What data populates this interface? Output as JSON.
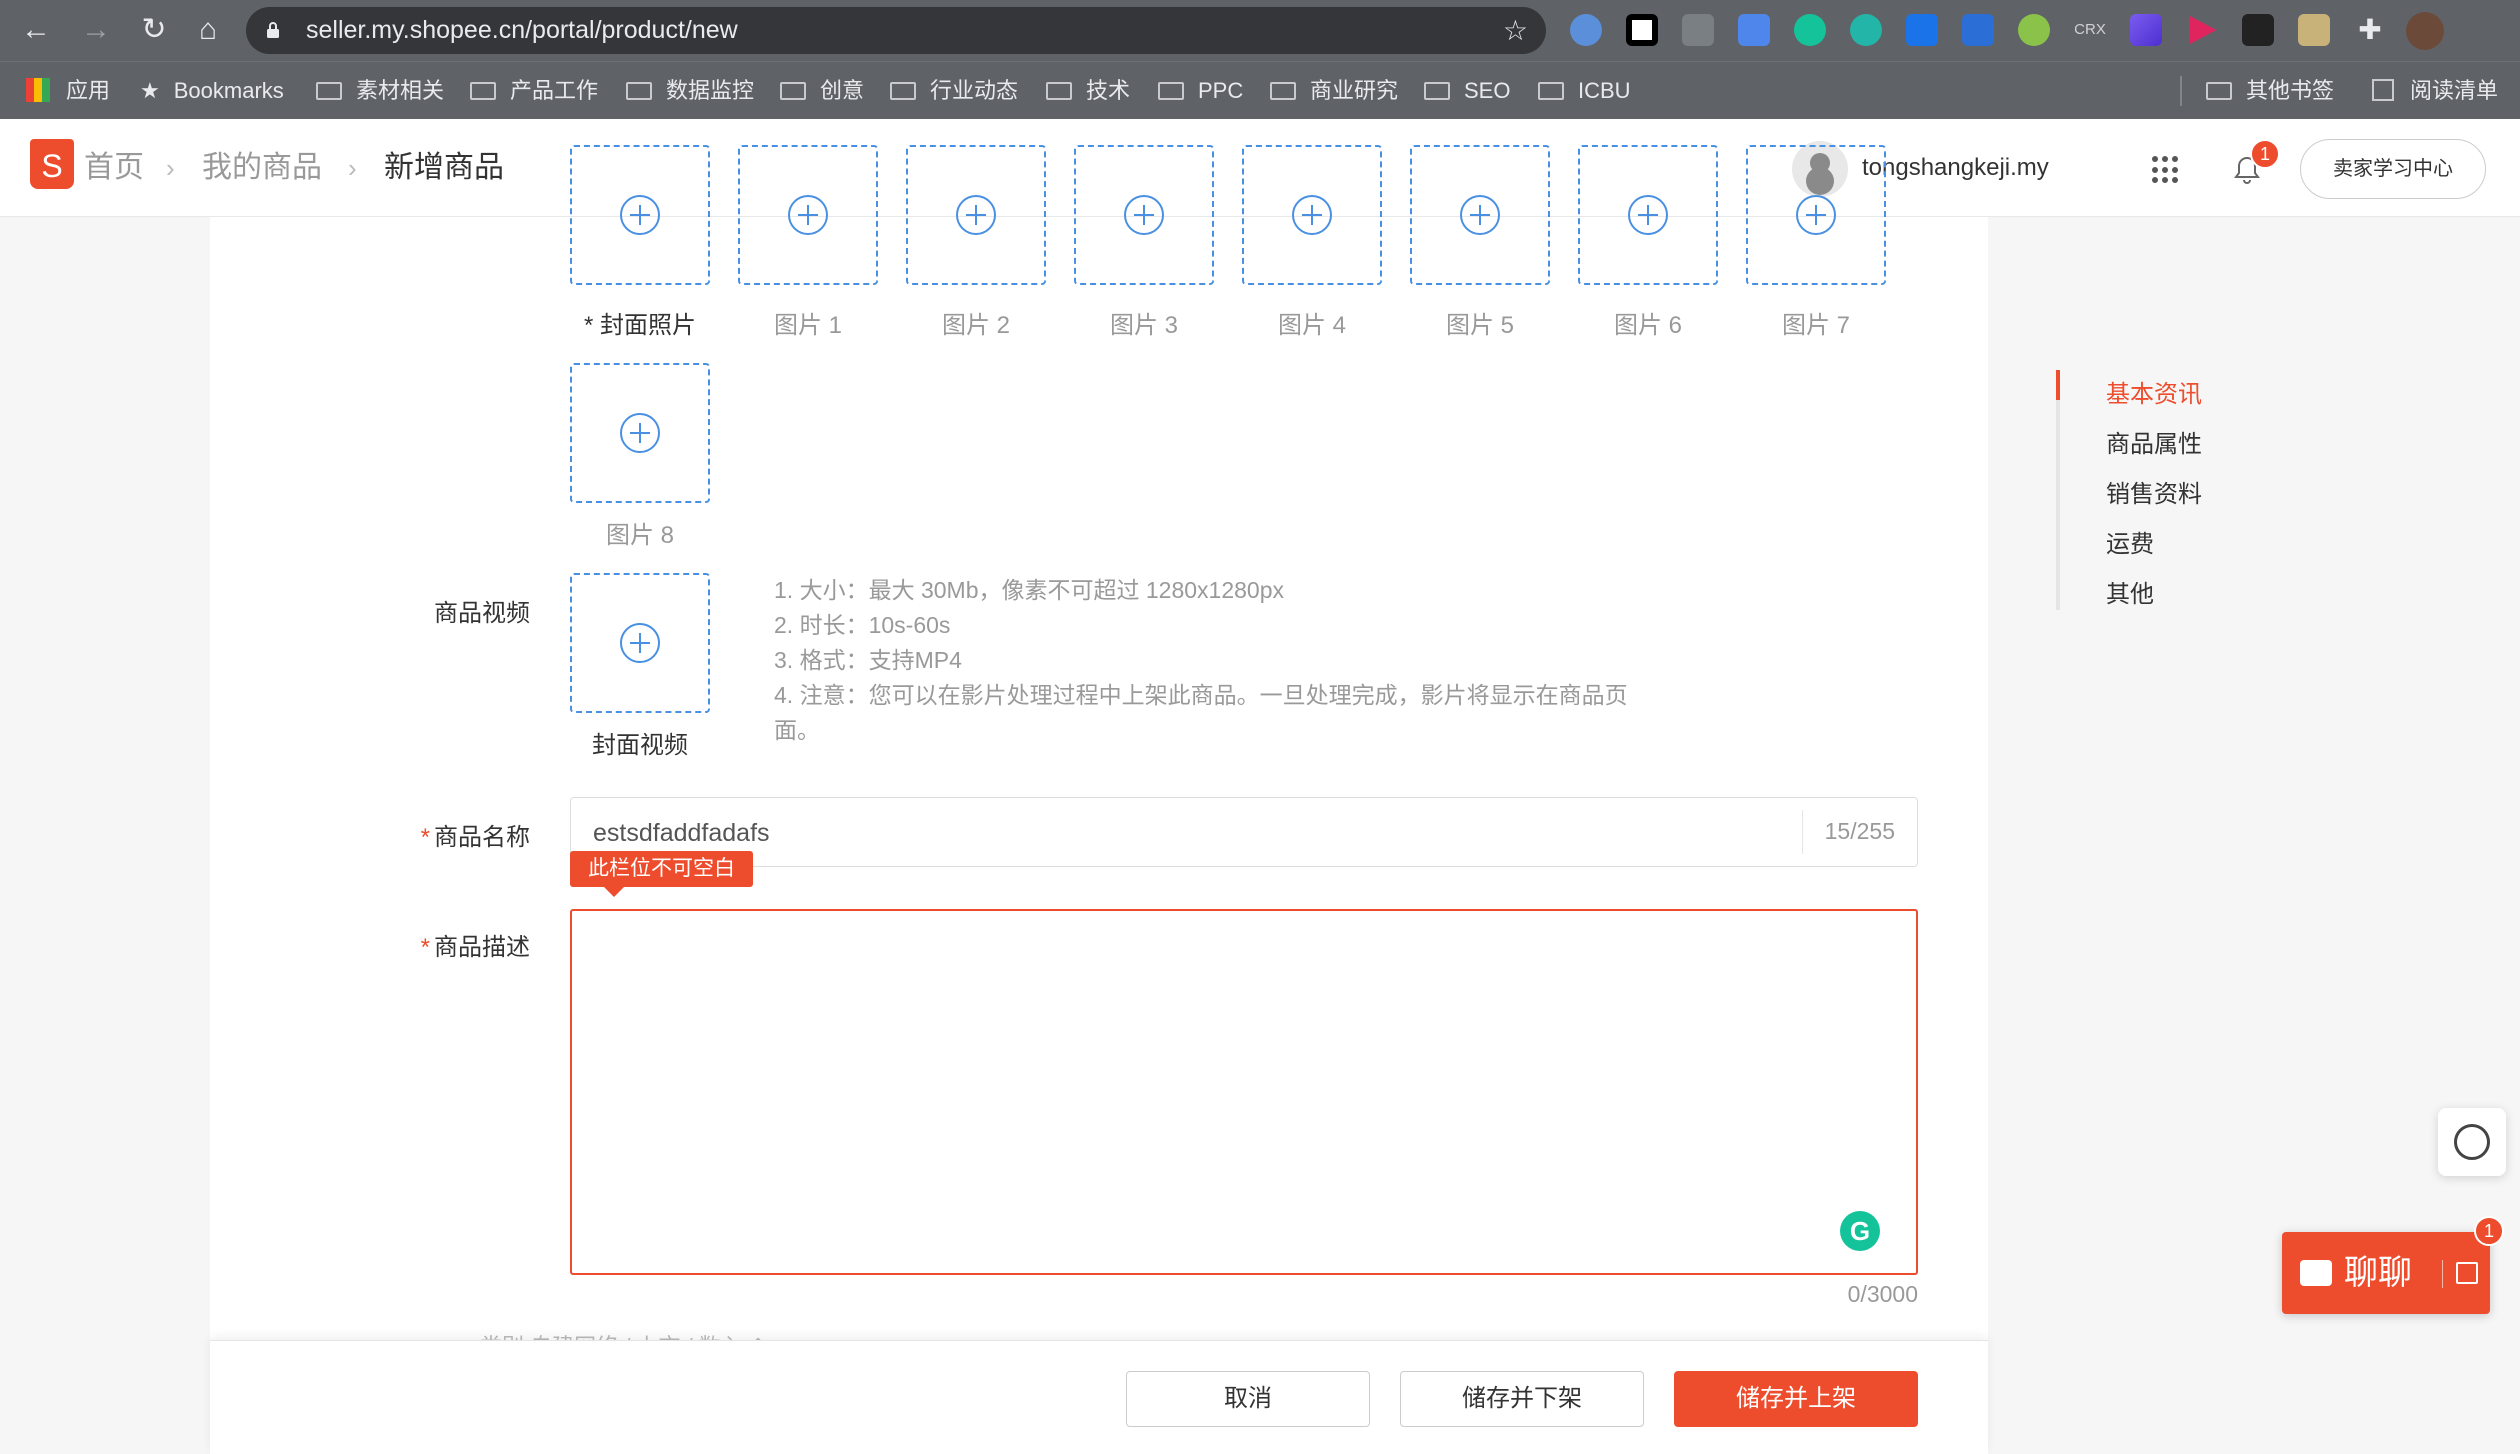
{
  "browser": {
    "url": "seller.my.shopee.cn/portal/product/new",
    "bookmarks": [
      "应用",
      "Bookmarks",
      "素材相关",
      "产品工作",
      "数据监控",
      "创意",
      "行业动态",
      "技术",
      "PPC",
      "商业研究",
      "SEO",
      "ICBU"
    ],
    "bookmarks_right": [
      "其他书签",
      "阅读清单"
    ],
    "extensions_icons": [
      "edge-icon",
      "screenshot-icon",
      "code-icon",
      "translate-icon",
      "grammarly-icon",
      "m-icon",
      "s-icon",
      "book-icon",
      "circle-icon",
      "crx-icon",
      "triangle-icon",
      "play-icon",
      "mask-icon",
      "image-icon",
      "puzzle-icon"
    ],
    "ext_crx_label": "CRX"
  },
  "header": {
    "logo_letter": "S",
    "breadcrumb": [
      "首页",
      "我的商品",
      "新增商品"
    ],
    "username": "tongshangkeji.my",
    "notification_count": "1",
    "learn_center": "卖家学习中心"
  },
  "images": {
    "labels": [
      "封面照片",
      "图片 1",
      "图片 2",
      "图片 3",
      "图片 4",
      "图片 5",
      "图片 6",
      "图片 7",
      "图片 8"
    ],
    "cover_marker": "*"
  },
  "video": {
    "label": "商品视频",
    "cover_label": "封面视频",
    "notes": [
      "1. 大小：最大 30Mb，像素不可超过 1280x1280px",
      "2. 时长：10s-60s",
      "3. 格式：支持MP4",
      "4. 注意：您可以在影片处理过程中上架此商品。一旦处理完成，影片将显示在商品页面。"
    ]
  },
  "product_name": {
    "required": "*",
    "label": "商品名称",
    "value": "estsdfaddfadafs",
    "counter": "15/255",
    "error": "此栏位不可空白"
  },
  "description": {
    "required": "*",
    "label": "商品描述",
    "counter": "0/3000",
    "grammarly_letter": "G"
  },
  "faded_row": "类别    自建网络 / 上市 / 数入 ⌃",
  "actions": {
    "cancel": "取消",
    "save_delist": "储存并下架",
    "save_publish": "储存并上架"
  },
  "side_nav": {
    "items": [
      "基本资讯",
      "商品属性",
      "销售资料",
      "运费",
      "其他"
    ],
    "active_index": 0
  },
  "chat": {
    "label": "聊聊",
    "badge": "1"
  },
  "colors": {
    "brand": "#ee4d2d",
    "uploader_border": "#4a90e2",
    "browser_chrome": "#5f6368"
  }
}
